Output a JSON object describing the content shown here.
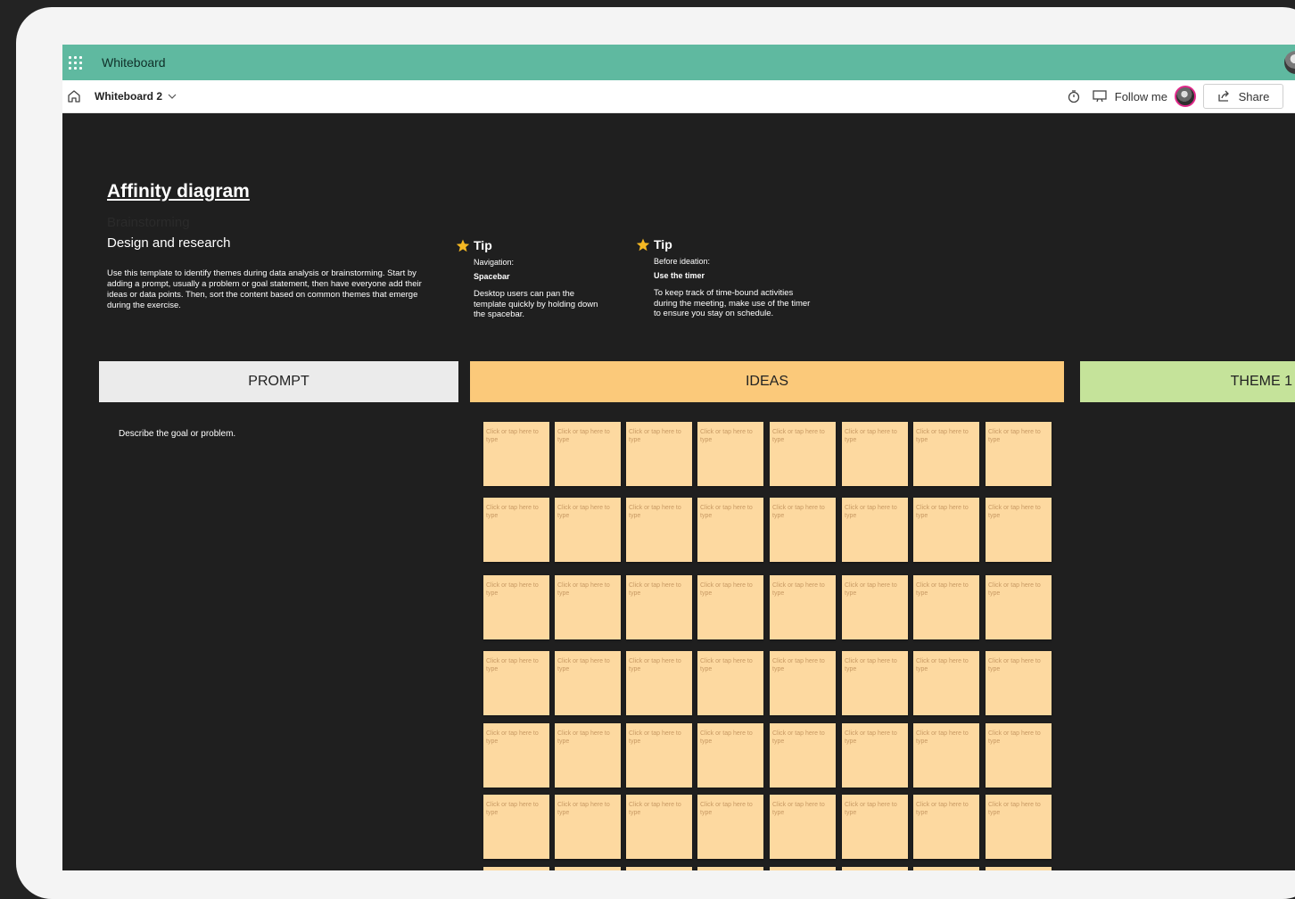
{
  "app": {
    "title": "Whiteboard"
  },
  "command_bar": {
    "board_name": "Whiteboard 2",
    "follow_label": "Follow me",
    "share_label": "Share"
  },
  "canvas": {
    "title": "Affinity diagram",
    "subtitle_hidden": "Brainstorming",
    "subtitle": "Design and research",
    "intro": "Use this template to identify themes during data analysis or brainstorming. Start by adding a prompt, usually a problem or goal statement, then have everyone add their ideas or data points. Then, sort the content based on common themes that emerge during the exercise.",
    "tips": [
      {
        "heading": "Tip",
        "category": "Navigation:",
        "name": "Spacebar",
        "body": "Desktop users can pan the template quickly by holding down the spacebar."
      },
      {
        "heading": "Tip",
        "category": "Before ideation:",
        "name": "Use the timer",
        "body": "To keep track of time-bound activities during the meeting, make use of the timer to ensure you stay on schedule."
      }
    ],
    "columns": [
      {
        "label": "PROMPT",
        "color": "#ebebeb"
      },
      {
        "label": "IDEAS",
        "color": "#fbc97a"
      },
      {
        "label": "THEME 1",
        "color": "#c5e39a"
      }
    ],
    "prompt_text": "Describe the goal or problem.",
    "note_placeholder": "Click or tap here to type"
  },
  "icons": [
    "app-launcher-icon",
    "home-icon",
    "chevron-down-icon",
    "timer-icon",
    "follow-icon",
    "share-icon",
    "gear-icon",
    "star-icon"
  ]
}
